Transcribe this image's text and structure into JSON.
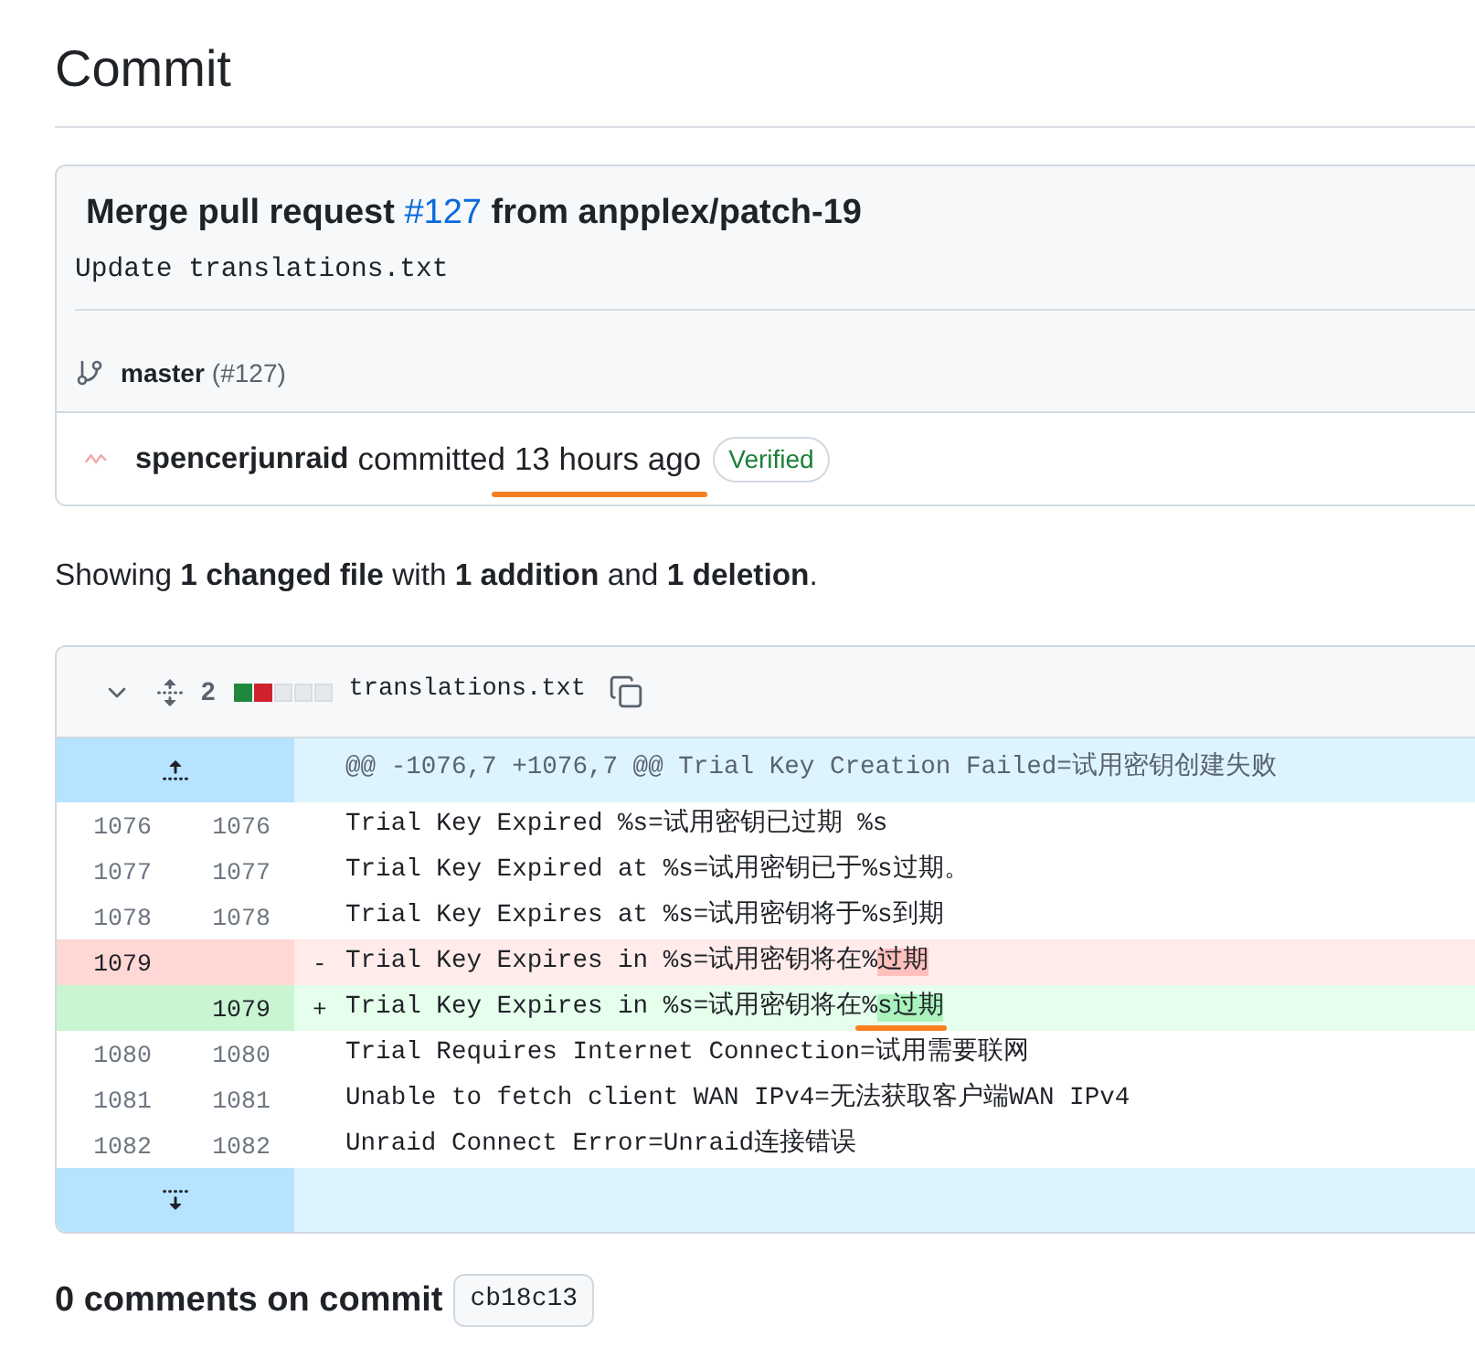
{
  "page_title": "Commit",
  "commit": {
    "title": {
      "prefix": "Merge pull request ",
      "link": "#127",
      "suffix": " from anpplex/patch-19"
    },
    "message": "Update translations.txt",
    "branch": "master",
    "branch_pr": "(#127)",
    "author": "spencerjunraid",
    "action": "committed",
    "time": {
      "text": "13 hours ago",
      "underlined": true
    },
    "badge": "Verified"
  },
  "summary": "Showing **1 changed file** with **1 addition** and **1 deletion**.",
  "file": {
    "expanded": true,
    "changes": "2",
    "diffstat": [
      {
        "kind": "addition"
      },
      {
        "kind": "deletion"
      },
      {
        "kind": "neutral"
      },
      {
        "kind": "neutral"
      },
      {
        "kind": "neutral"
      }
    ],
    "name": "translations.txt",
    "hunk_header": "@@ -1076,7 +1076,7 @@ Trial Key Creation Failed=试用密钥创建失败",
    "lines": [
      {
        "kind": "context",
        "old": "1076",
        "new": "1076",
        "text": "Trial Key Expired %s=试用密钥已过期 %s"
      },
      {
        "kind": "context",
        "old": "1077",
        "new": "1077",
        "text": "Trial Key Expired at %s=试用密钥已于%s过期。"
      },
      {
        "kind": "context",
        "old": "1078",
        "new": "1078",
        "text": "Trial Key Expires at %s=试用密钥将于%s到期"
      },
      {
        "kind": "deletion",
        "old": "1079",
        "sign": "-",
        "segments": [
          {
            "text": "Trial Key Expires in %s=试用密钥将在%",
            "highlight": false,
            "underlined": false
          },
          {
            "text": "过期",
            "highlight": true,
            "underlined": false
          }
        ]
      },
      {
        "kind": "addition",
        "new": "1079",
        "sign": "+",
        "segments": [
          {
            "text": "Trial Key Expires in %s=试用密钥将在",
            "highlight": false,
            "underlined": false
          },
          {
            "text": "%",
            "highlight": false,
            "underlined": true
          },
          {
            "text": "s过期",
            "highlight": true,
            "underlined": true
          }
        ]
      },
      {
        "kind": "context",
        "old": "1080",
        "new": "1080",
        "text": "Trial Requires Internet Connection=试用需要联网"
      },
      {
        "kind": "context",
        "old": "1081",
        "new": "1081",
        "text": "Unable to fetch client WAN IPv4=无法获取客户端WAN IPv4"
      },
      {
        "kind": "context",
        "old": "1082",
        "new": "1082",
        "text": "Unraid Connect Error=Unraid连接错误"
      }
    ]
  },
  "comments": {
    "text": "0 comments on commit",
    "sha": "cb18c13"
  }
}
